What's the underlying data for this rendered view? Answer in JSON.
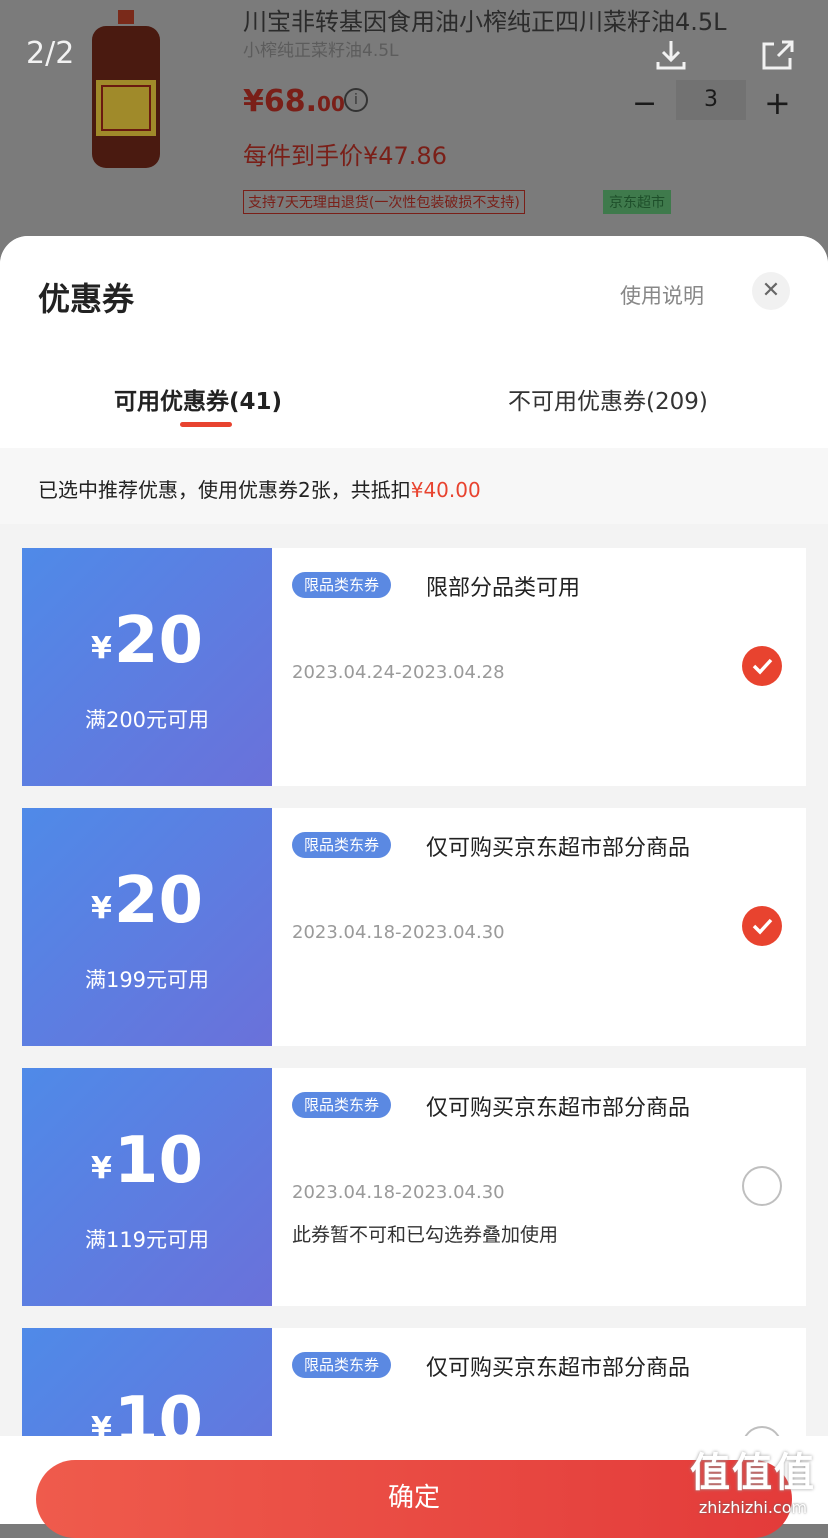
{
  "pager": "2/2",
  "product": {
    "title": "川宝非转基因食用油小榨纯正四川菜籽油4.5L",
    "subtitle": "小榨纯正菜籽油4.5L",
    "price_int": "¥68.",
    "price_dec": "00",
    "unit_price": "每件到手价¥47.86",
    "promo": "支持7天无理由退货(一次性包装破损不支持)",
    "store": "京东超市",
    "quantity": "3"
  },
  "sheet": {
    "title": "优惠券",
    "help": "使用说明",
    "tabs": [
      "可用优惠券(41)",
      "不可用优惠券(209)"
    ],
    "summary_prefix": "已选中推荐优惠，使用优惠券2张，共抵扣",
    "summary_amount": "¥40.00"
  },
  "coupons": [
    {
      "currency": "¥",
      "amount": "20",
      "condition": "满200元可用",
      "tag": "限品类东券",
      "desc": "限部分品类可用",
      "date": "2023.04.24-2023.04.28",
      "note": "",
      "selected": true
    },
    {
      "currency": "¥",
      "amount": "20",
      "condition": "满199元可用",
      "tag": "限品类东券",
      "desc": "仅可购买京东超市部分商品",
      "date": "2023.04.18-2023.04.30",
      "note": "",
      "selected": true
    },
    {
      "currency": "¥",
      "amount": "10",
      "condition": "满119元可用",
      "tag": "限品类东券",
      "desc": "仅可购买京东超市部分商品",
      "date": "2023.04.18-2023.04.30",
      "note": "此券暂不可和已勾选券叠加使用",
      "selected": false
    },
    {
      "currency": "¥",
      "amount": "10",
      "condition": "",
      "tag": "限品类东券",
      "desc": "仅可购买京东超市部分商品",
      "date": "",
      "note": "",
      "selected": false
    }
  ],
  "footer": {
    "confirm": "确定"
  },
  "watermark": {
    "text": "值值值",
    "url": "zhizhizhi.com"
  },
  "colors": {
    "accent": "#e8432f",
    "coupon_blue": "#5b7fe0"
  }
}
